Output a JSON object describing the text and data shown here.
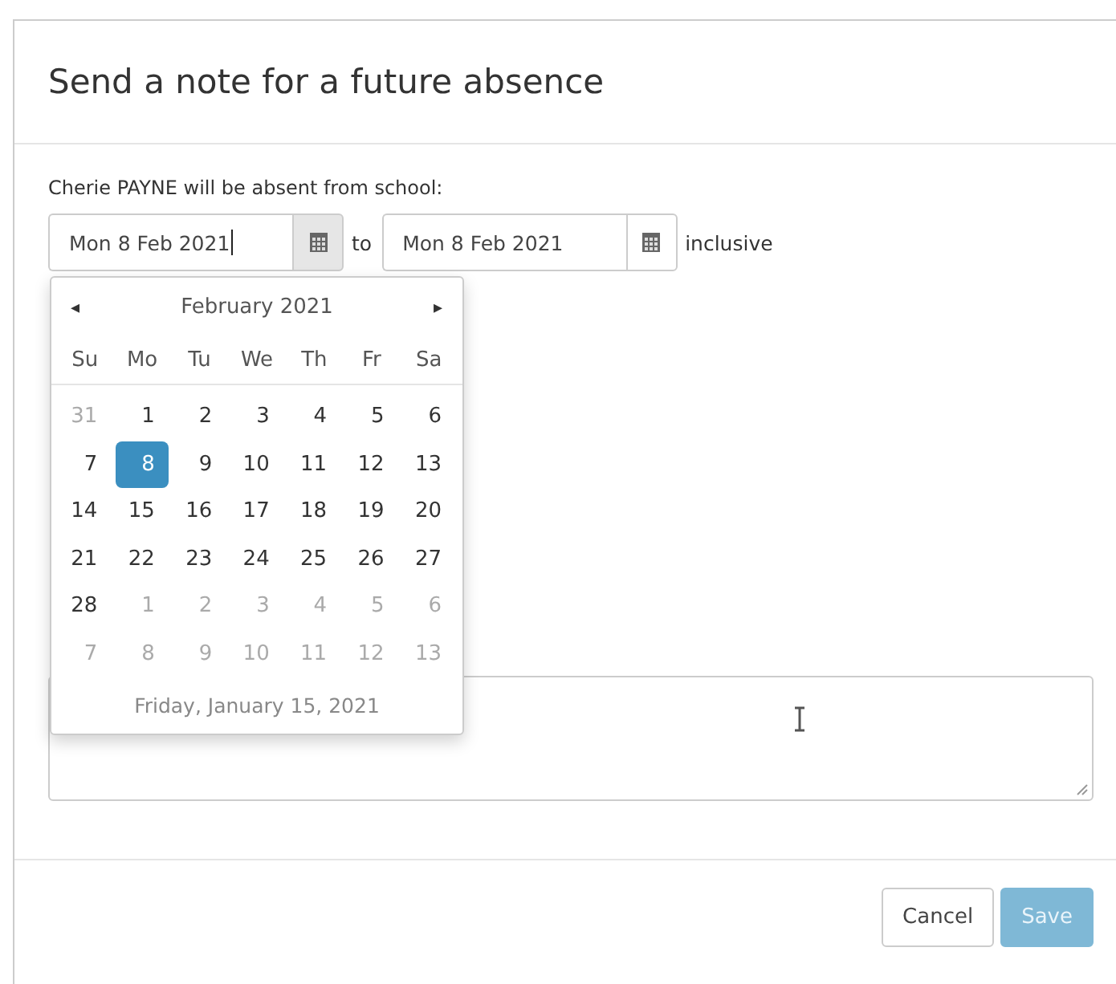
{
  "dialog": {
    "title": "Send a note for a future absence"
  },
  "intro": "Cherie PAYNE will be absent from school:",
  "from_field": {
    "value": "Mon 8 Feb 2021",
    "focused": true
  },
  "to_label": "to",
  "to_field": {
    "value": "Mon 8 Feb 2021",
    "focused": false
  },
  "suffix": "inclusive",
  "datepicker": {
    "prev": "◂",
    "month": "February 2021",
    "next": "▸",
    "weekdays": [
      "Su",
      "Mo",
      "Tu",
      "We",
      "Th",
      "Fr",
      "Sa"
    ],
    "weeks": [
      [
        {
          "day": "31",
          "muted": true,
          "selected": false
        },
        {
          "day": "1",
          "muted": false,
          "selected": false
        },
        {
          "day": "2",
          "muted": false,
          "selected": false
        },
        {
          "day": "3",
          "muted": false,
          "selected": false
        },
        {
          "day": "4",
          "muted": false,
          "selected": false
        },
        {
          "day": "5",
          "muted": false,
          "selected": false
        },
        {
          "day": "6",
          "muted": false,
          "selected": false
        }
      ],
      [
        {
          "day": "7",
          "muted": false,
          "selected": false
        },
        {
          "day": "8",
          "muted": false,
          "selected": true
        },
        {
          "day": "9",
          "muted": false,
          "selected": false
        },
        {
          "day": "10",
          "muted": false,
          "selected": false
        },
        {
          "day": "11",
          "muted": false,
          "selected": false
        },
        {
          "day": "12",
          "muted": false,
          "selected": false
        },
        {
          "day": "13",
          "muted": false,
          "selected": false
        }
      ],
      [
        {
          "day": "14",
          "muted": false,
          "selected": false
        },
        {
          "day": "15",
          "muted": false,
          "selected": false
        },
        {
          "day": "16",
          "muted": false,
          "selected": false
        },
        {
          "day": "17",
          "muted": false,
          "selected": false
        },
        {
          "day": "18",
          "muted": false,
          "selected": false
        },
        {
          "day": "19",
          "muted": false,
          "selected": false
        },
        {
          "day": "20",
          "muted": false,
          "selected": false
        }
      ],
      [
        {
          "day": "21",
          "muted": false,
          "selected": false
        },
        {
          "day": "22",
          "muted": false,
          "selected": false
        },
        {
          "day": "23",
          "muted": false,
          "selected": false
        },
        {
          "day": "24",
          "muted": false,
          "selected": false
        },
        {
          "day": "25",
          "muted": false,
          "selected": false
        },
        {
          "day": "26",
          "muted": false,
          "selected": false
        },
        {
          "day": "27",
          "muted": false,
          "selected": false
        }
      ],
      [
        {
          "day": "28",
          "muted": false,
          "selected": false
        },
        {
          "day": "1",
          "muted": true,
          "selected": false
        },
        {
          "day": "2",
          "muted": true,
          "selected": false
        },
        {
          "day": "3",
          "muted": true,
          "selected": false
        },
        {
          "day": "4",
          "muted": true,
          "selected": false
        },
        {
          "day": "5",
          "muted": true,
          "selected": false
        },
        {
          "day": "6",
          "muted": true,
          "selected": false
        }
      ],
      [
        {
          "day": "7",
          "muted": true,
          "selected": false
        },
        {
          "day": "8",
          "muted": true,
          "selected": false
        },
        {
          "day": "9",
          "muted": true,
          "selected": false
        },
        {
          "day": "10",
          "muted": true,
          "selected": false
        },
        {
          "day": "11",
          "muted": true,
          "selected": false
        },
        {
          "day": "12",
          "muted": true,
          "selected": false
        },
        {
          "day": "13",
          "muted": true,
          "selected": false
        }
      ]
    ],
    "today": "Friday, January 15, 2021"
  },
  "buttons": [
    {
      "label": "Cancel",
      "kind": "default",
      "disabled": false
    },
    {
      "label": "Save",
      "kind": "primary",
      "disabled": true
    }
  ]
}
